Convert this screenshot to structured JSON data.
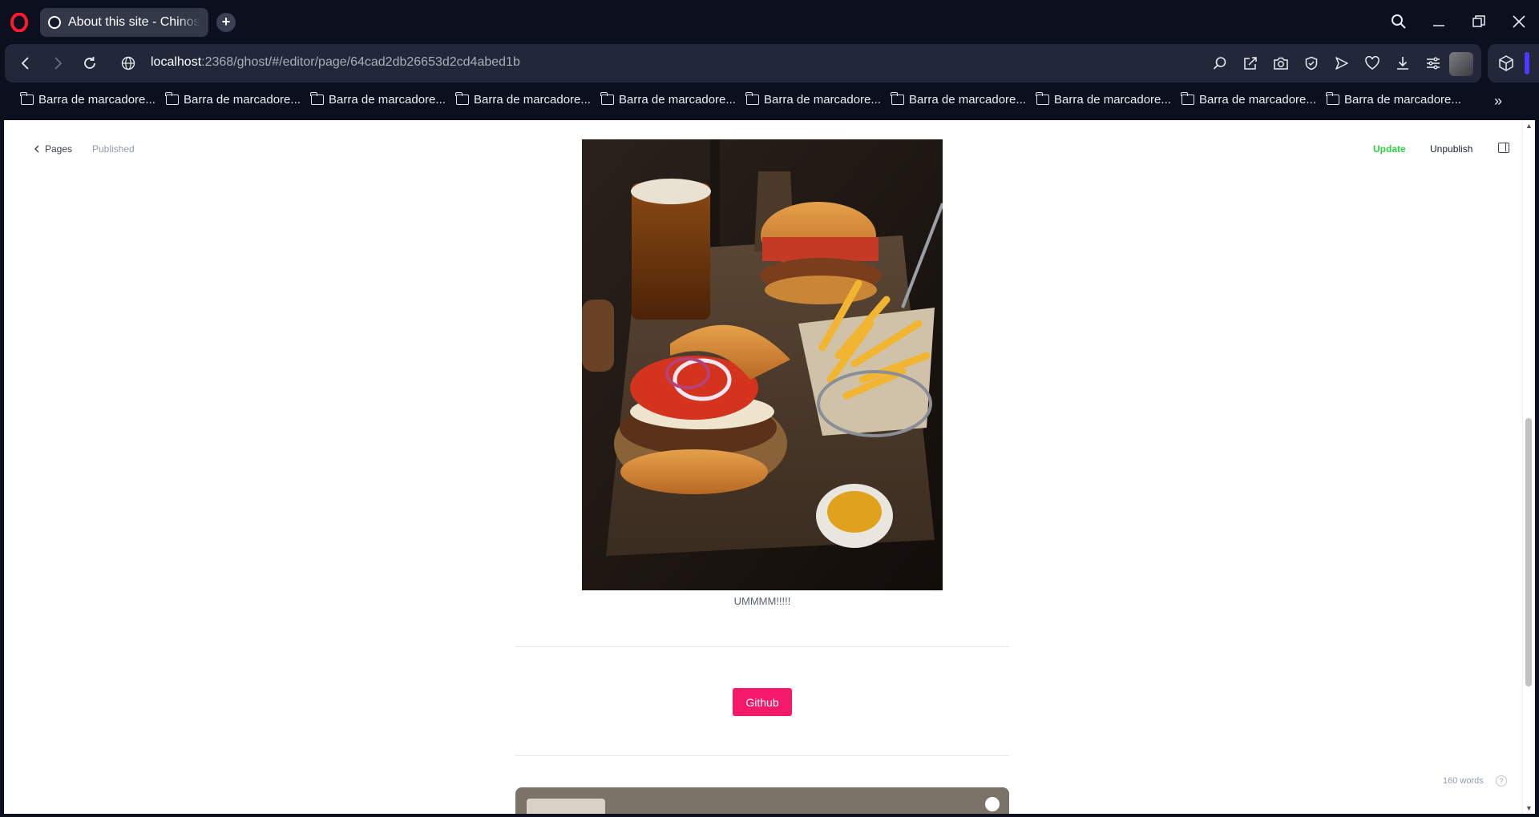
{
  "browser": {
    "tab_title": "About this site - Chinos Ar",
    "url_host": "localhost",
    "url_path": ":2368/ghost/#/editor/page/64cad2db26653d2cd4abed1b",
    "bookmarks": [
      "Barra de marcadore...",
      "Barra de marcadore...",
      "Barra de marcadore...",
      "Barra de marcadore...",
      "Barra de marcadore...",
      "Barra de marcadore...",
      "Barra de marcadore...",
      "Barra de marcadore...",
      "Barra de marcadore...",
      "Barra de marcadore..."
    ],
    "accent_color": "#4a3bff"
  },
  "editor": {
    "back_label": "Pages",
    "status": "Published",
    "update_label": "Update",
    "unpublish_label": "Unpublish",
    "image_caption": "UMMMM!!!!!",
    "button_label": "Github",
    "word_count": "160 words",
    "help_glyph": "?",
    "accent_color": "#f4196a",
    "update_color": "#30cf43"
  }
}
